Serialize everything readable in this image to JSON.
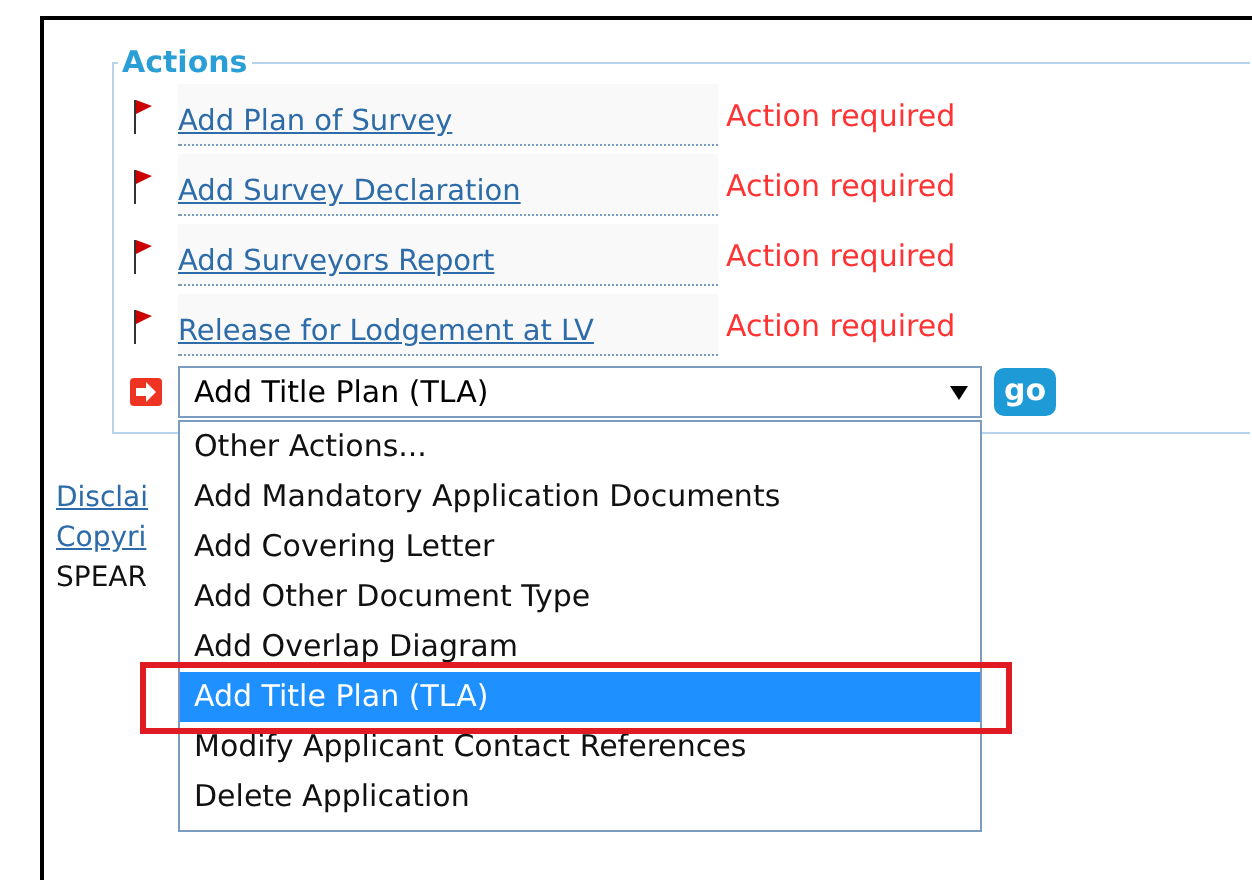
{
  "actions": {
    "legend": "Actions",
    "rows": [
      {
        "link": "Add Plan of Survey",
        "status": "Action required"
      },
      {
        "link": "Add Survey Declaration",
        "status": "Action required"
      },
      {
        "link": "Add Surveyors Report",
        "status": "Action required"
      },
      {
        "link": "Release for Lodgement at LV",
        "status": "Action required"
      }
    ],
    "select": {
      "value": "Add Title Plan (TLA)",
      "expanded": true,
      "options": [
        {
          "label": "Other Actions...",
          "selected": false,
          "highlighted": false
        },
        {
          "label": "Add Mandatory Application Documents",
          "selected": false,
          "highlighted": false
        },
        {
          "label": "Add Covering Letter",
          "selected": false,
          "highlighted": false
        },
        {
          "label": "Add Other Document Type",
          "selected": false,
          "highlighted": false
        },
        {
          "label": "Add Overlap Diagram",
          "selected": false,
          "highlighted": false
        },
        {
          "label": "Add Title Plan (TLA)",
          "selected": true,
          "highlighted": true
        },
        {
          "label": "Modify Applicant Contact References",
          "selected": false,
          "highlighted": false
        },
        {
          "label": "Delete Application",
          "selected": false,
          "highlighted": false
        }
      ]
    },
    "go_button": "go"
  },
  "footer": [
    {
      "kind": "link",
      "text": "Disclai"
    },
    {
      "kind": "link",
      "text": "Copyri"
    },
    {
      "kind": "text",
      "text": "SPEAR"
    }
  ]
}
